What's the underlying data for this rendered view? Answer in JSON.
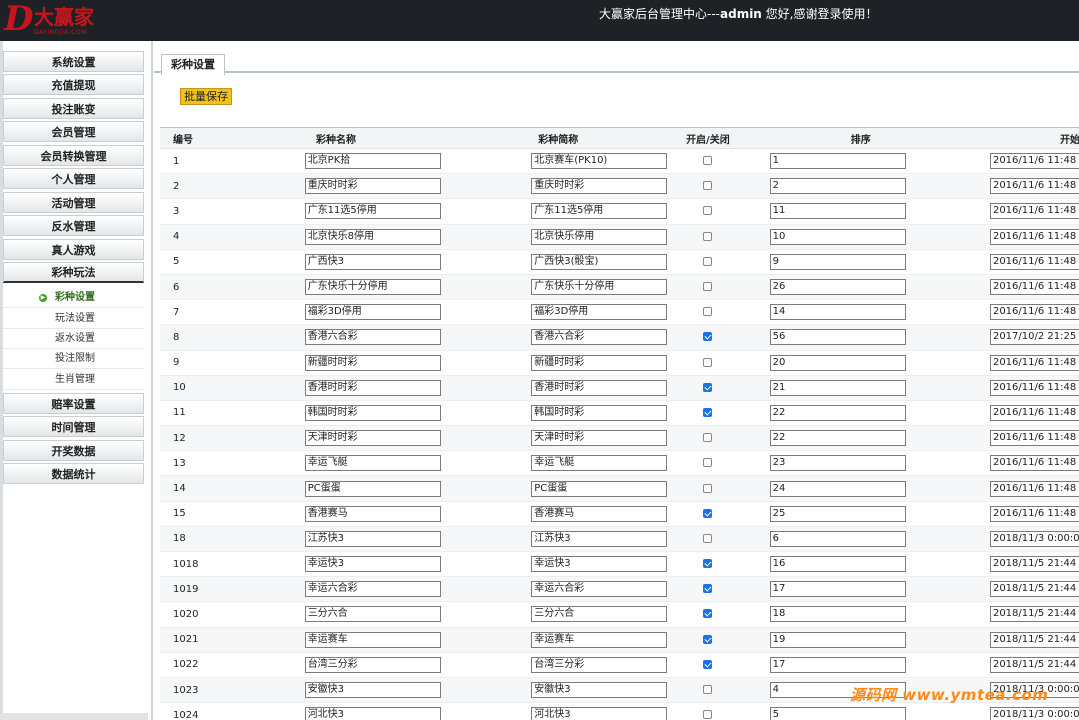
{
  "header": {
    "logo_mark": "D",
    "logo_text": "大赢家",
    "logo_sub": "DAYINGJIA.COM",
    "welcome_prefix": "大赢家后台管理中心---",
    "welcome_user": "admin",
    "welcome_suffix": " 您好,感谢登录使用！"
  },
  "sidebar": {
    "menu": [
      {
        "label": "系统设置"
      },
      {
        "label": "充值提现"
      },
      {
        "label": "投注账变"
      },
      {
        "label": "会员管理"
      },
      {
        "label": "会员转换管理"
      },
      {
        "label": "个人管理"
      },
      {
        "label": "活动管理"
      },
      {
        "label": "反水管理"
      },
      {
        "label": "真人游戏"
      },
      {
        "label": "彩种玩法"
      }
    ],
    "submenu": [
      {
        "label": "彩种设置",
        "active": true
      },
      {
        "label": "玩法设置"
      },
      {
        "label": "返水设置"
      },
      {
        "label": "投注限制"
      },
      {
        "label": "生肖管理"
      }
    ],
    "menu_after": [
      {
        "label": "赔率设置"
      },
      {
        "label": "时间管理"
      },
      {
        "label": "开奖数据"
      },
      {
        "label": "数据统计"
      }
    ]
  },
  "tab": {
    "label": "彩种设置"
  },
  "toolbar": {
    "batch_save": "批量保存"
  },
  "table": {
    "headers": [
      "编号",
      "彩种名称",
      "彩种简称",
      "开启/关闭",
      "排序",
      "开始关盘"
    ],
    "rows": [
      {
        "id": "1",
        "name": "北京PK拾",
        "short": "北京赛车(PK10)",
        "open": false,
        "sort": "1",
        "time": "2016/11/6 11:48"
      },
      {
        "id": "2",
        "name": "重庆时时彩",
        "short": "重庆时时彩",
        "open": false,
        "sort": "2",
        "time": "2016/11/6 11:48"
      },
      {
        "id": "3",
        "name": "广东11选5停用",
        "short": "广东11选5停用",
        "open": false,
        "sort": "11",
        "time": "2016/11/6 11:48"
      },
      {
        "id": "4",
        "name": "北京快乐8停用",
        "short": "北京快乐停用",
        "open": false,
        "sort": "10",
        "time": "2016/11/6 11:48"
      },
      {
        "id": "5",
        "name": "广西快3",
        "short": "广西快3(骰宝)",
        "open": false,
        "sort": "9",
        "time": "2016/11/6 11:48"
      },
      {
        "id": "6",
        "name": "广东快乐十分停用",
        "short": "广东快乐十分停用",
        "open": false,
        "sort": "26",
        "time": "2016/11/6 11:48"
      },
      {
        "id": "7",
        "name": "福彩3D停用",
        "short": "福彩3D停用",
        "open": false,
        "sort": "14",
        "time": "2016/11/6 11:48"
      },
      {
        "id": "8",
        "name": "香港六合彩",
        "short": "香港六合彩",
        "open": true,
        "sort": "56",
        "time": "2017/10/2 21:25"
      },
      {
        "id": "9",
        "name": "新疆时时彩",
        "short": "新疆时时彩",
        "open": false,
        "sort": "20",
        "time": "2016/11/6 11:48"
      },
      {
        "id": "10",
        "name": "香港时时彩",
        "short": "香港时时彩",
        "open": true,
        "sort": "21",
        "time": "2016/11/6 11:48"
      },
      {
        "id": "11",
        "name": "韩国时时彩",
        "short": "韩国时时彩",
        "open": true,
        "sort": "22",
        "time": "2016/11/6 11:48"
      },
      {
        "id": "12",
        "name": "天津时时彩",
        "short": "天津时时彩",
        "open": false,
        "sort": "22",
        "time": "2016/11/6 11:48"
      },
      {
        "id": "13",
        "name": "幸运飞艇",
        "short": "幸运飞艇",
        "open": false,
        "sort": "23",
        "time": "2016/11/6 11:48"
      },
      {
        "id": "14",
        "name": "PC蛋蛋",
        "short": "PC蛋蛋",
        "open": false,
        "sort": "24",
        "time": "2016/11/6 11:48"
      },
      {
        "id": "15",
        "name": "香港赛马",
        "short": "香港赛马",
        "open": true,
        "sort": "25",
        "time": "2016/11/6 11:48"
      },
      {
        "id": "18",
        "name": "江苏快3",
        "short": "江苏快3",
        "open": false,
        "sort": "6",
        "time": "2018/11/3 0:00:0"
      },
      {
        "id": "1018",
        "name": "幸运快3",
        "short": "幸运快3",
        "open": true,
        "sort": "16",
        "time": "2018/11/5 21:44"
      },
      {
        "id": "1019",
        "name": "幸运六合彩",
        "short": "幸运六合彩",
        "open": true,
        "sort": "17",
        "time": "2018/11/5 21:44"
      },
      {
        "id": "1020",
        "name": "三分六合",
        "short": "三分六合",
        "open": true,
        "sort": "18",
        "time": "2018/11/5 21:44"
      },
      {
        "id": "1021",
        "name": "幸运赛车",
        "short": "幸运赛车",
        "open": true,
        "sort": "19",
        "time": "2018/11/5 21:44"
      },
      {
        "id": "1022",
        "name": "台湾三分彩",
        "short": "台湾三分彩",
        "open": true,
        "sort": "17",
        "time": "2018/11/5 21:44"
      },
      {
        "id": "1023",
        "name": "安徽快3",
        "short": "安徽快3",
        "open": false,
        "sort": "4",
        "time": "2018/11/3 0:00:0"
      },
      {
        "id": "1024",
        "name": "河北快3",
        "short": "河北快3",
        "open": false,
        "sort": "5",
        "time": "2018/11/3 0:00:0"
      }
    ]
  },
  "watermark": "源码网 www.ymtea.com"
}
